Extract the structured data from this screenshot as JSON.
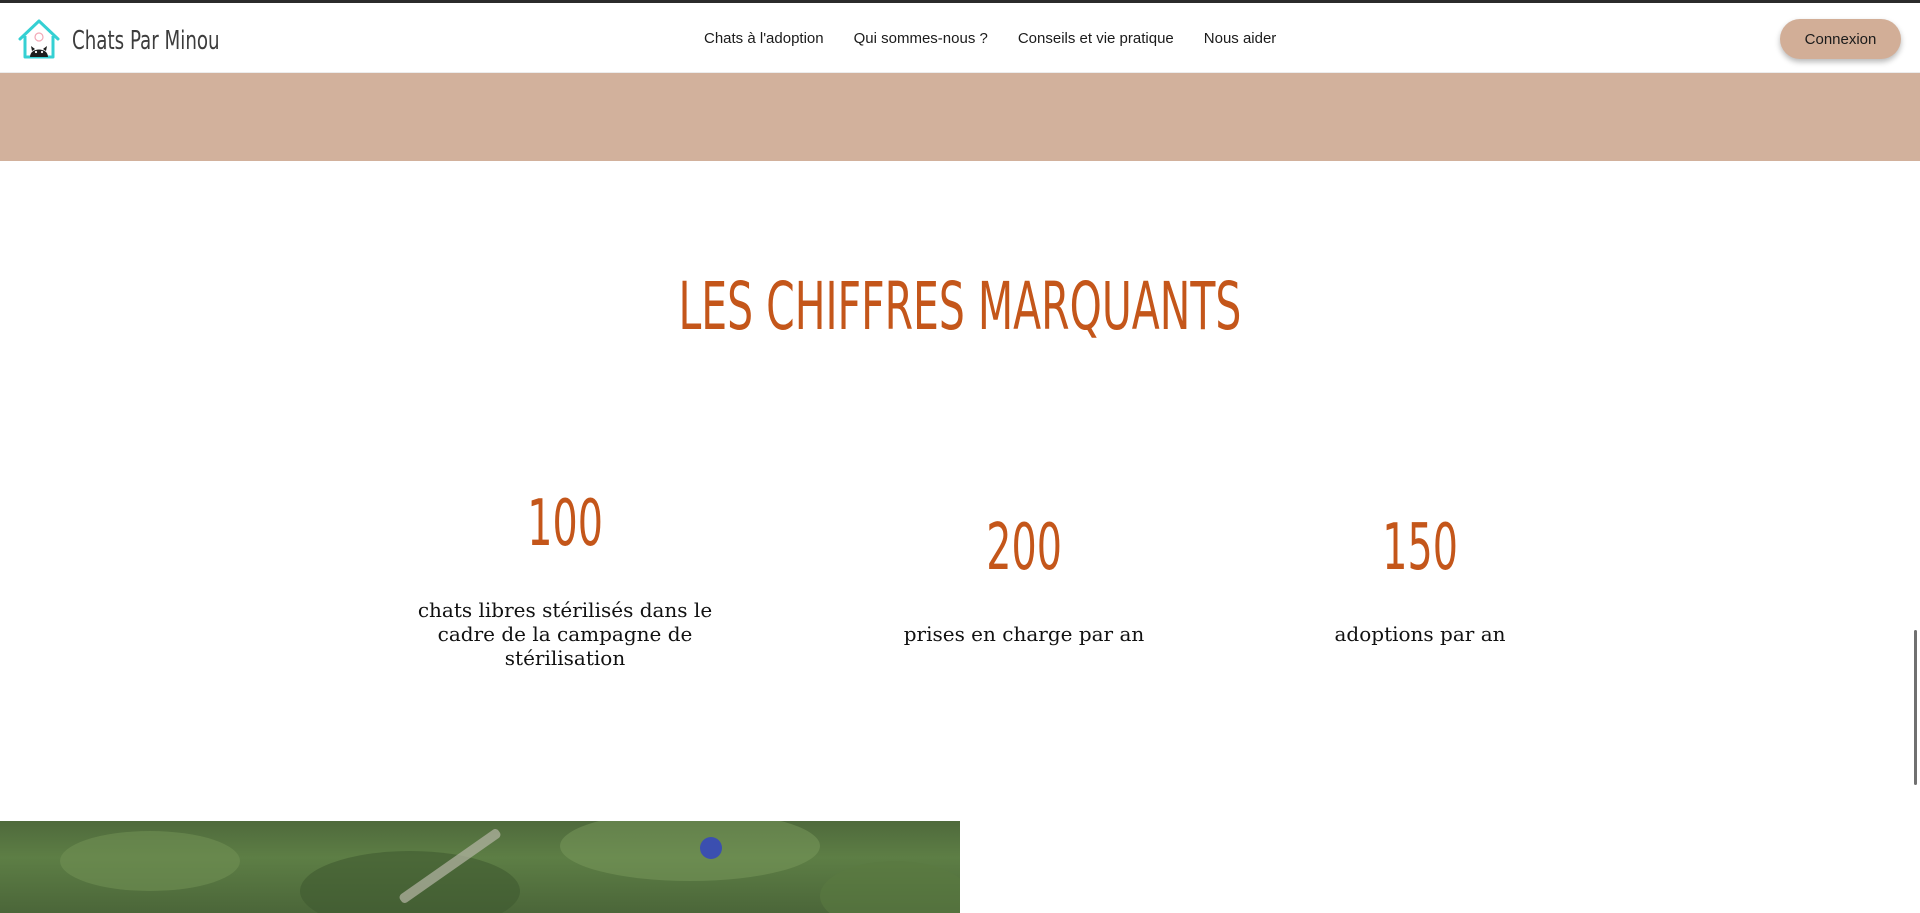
{
  "header": {
    "brand": "Chats Par Minou",
    "logo_icon": "cat-house-logo-icon",
    "nav": [
      {
        "label": "Chats à l'adoption"
      },
      {
        "label": "Qui sommes-nous ?"
      },
      {
        "label": "Conseils et vie pratique"
      },
      {
        "label": "Nous aider"
      }
    ],
    "login_label": "Connexion"
  },
  "colors": {
    "accent": "#c4561a",
    "band": "#d2b19c",
    "button": "#d2ae97"
  },
  "stats_section": {
    "title": "Les chiffres marquants",
    "items": [
      {
        "number": "100",
        "text": "chats libres stérilisés dans le cadre de la campagne de stérilisation"
      },
      {
        "number": "200",
        "text": "prises en charge par an"
      },
      {
        "number": "150",
        "text": "adoptions par an"
      }
    ]
  }
}
